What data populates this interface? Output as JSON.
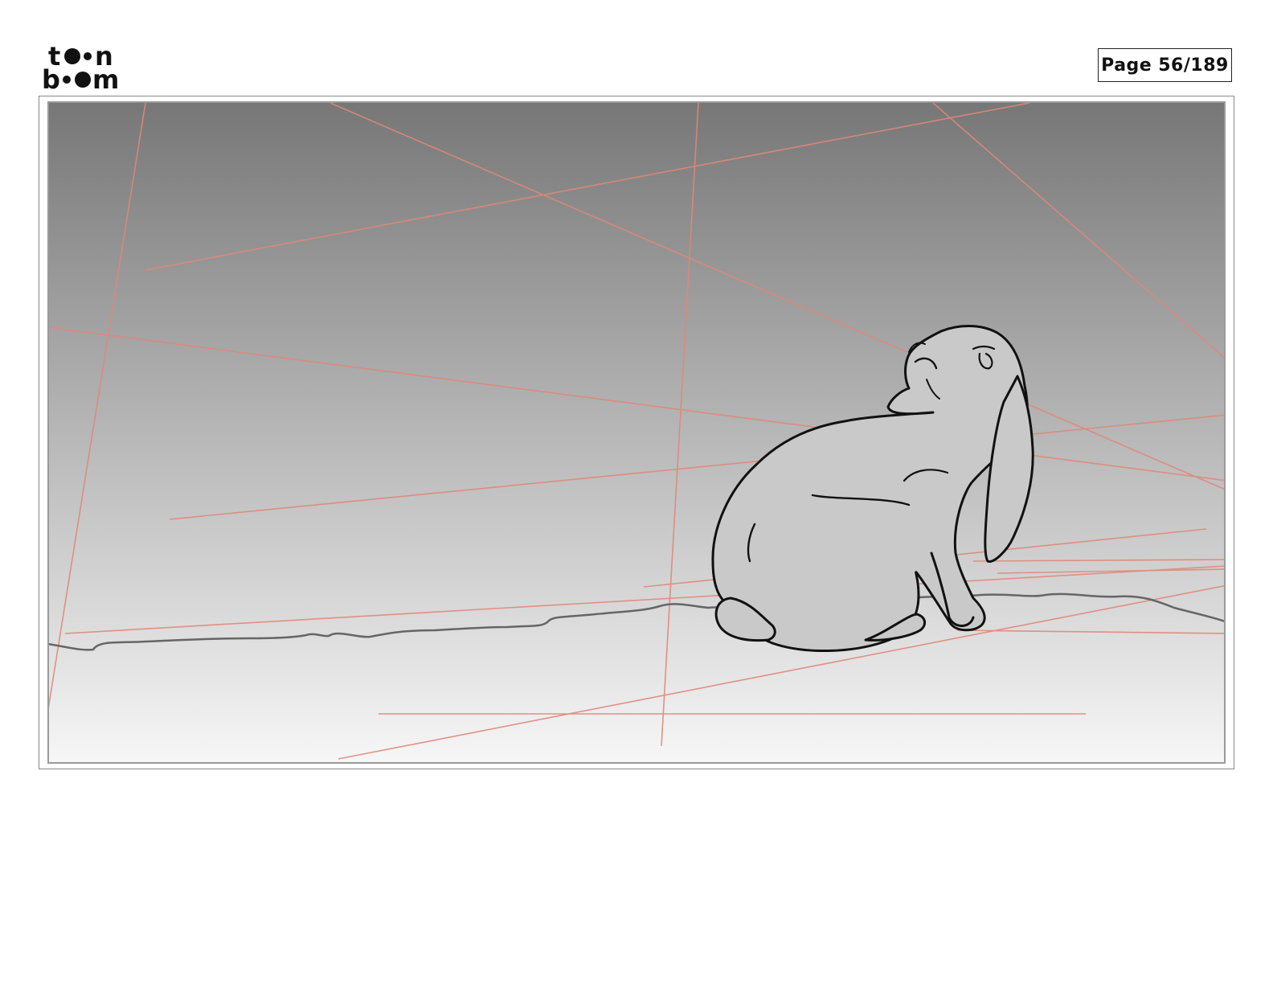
{
  "header": {
    "logo_line1": "toon",
    "logo_line2": "boom",
    "page_word": "Page",
    "page_number": "56/189"
  },
  "panel": {
    "sky_top_color": "#777777",
    "sky_bottom_color": "#f7f7f7",
    "guide_line_color": "#e08878",
    "rabbit_fill": "#c9c9c9",
    "ink_color": "#111111"
  }
}
